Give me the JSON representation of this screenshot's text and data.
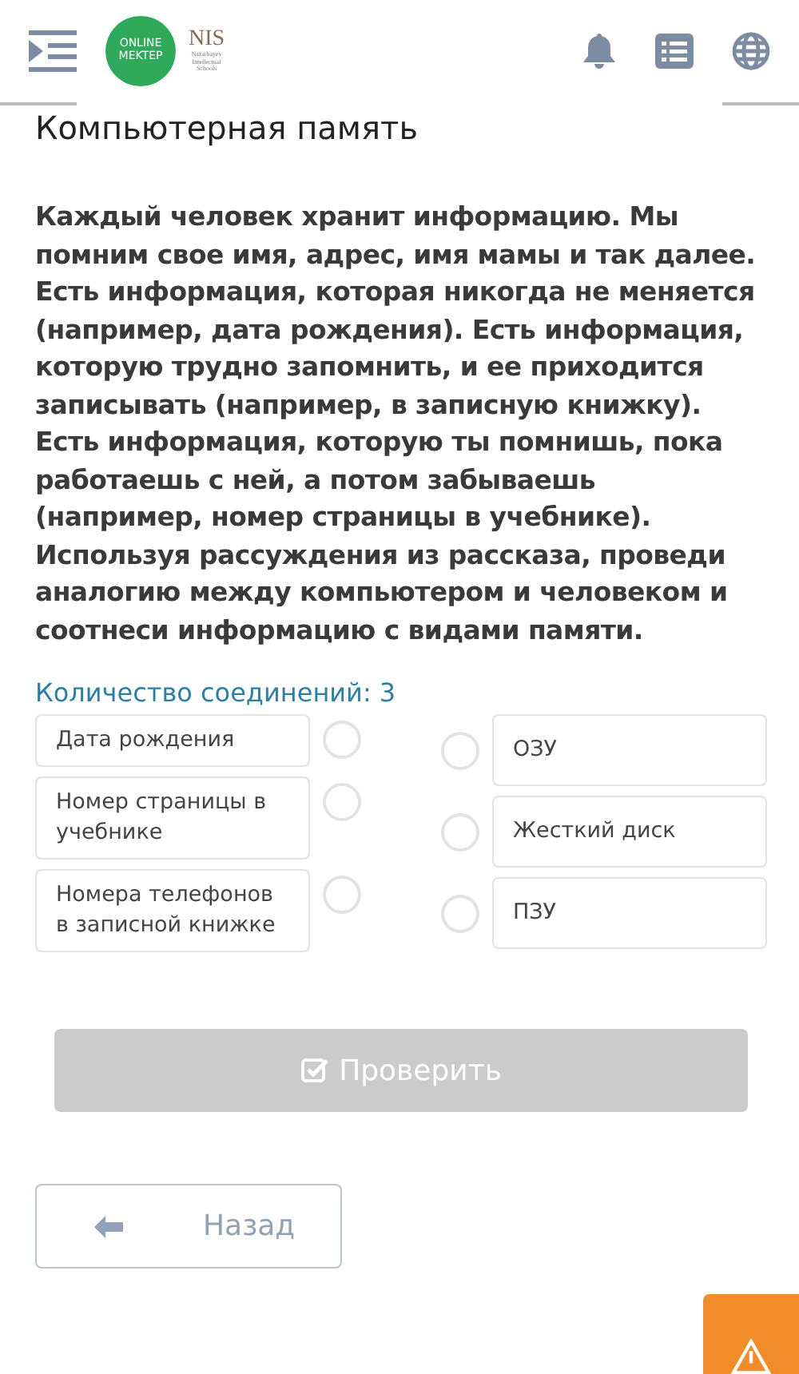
{
  "header": {
    "logo_main": [
      "ONLINE",
      "MEKTEP"
    ],
    "logo_nis": "NIS",
    "logo_nis_sub": [
      "Nazarbayev",
      "Intellectual",
      "Schools"
    ]
  },
  "title": "Компьютерная память",
  "question": "Каждый человек хранит информацию. Мы помним свое имя, адрес, имя мамы и так далее. Есть информация, которая никогда не меняется (например, дата рождения). Есть информация, которую трудно запомнить, и ее приходится записывать (например, в записную книжку). Есть информация, которую ты помнишь, пока работаешь с ней, а потом забываешь (например, номер страницы в учебнике). Используя рассуждения из рассказа, проведи аналогию между компьютером и человеком и соотнеси информацию с видами памяти.",
  "connections_label": "Количество соединений: 3",
  "left_items": [
    {
      "text": "Дата рождения",
      "selected": false
    },
    {
      "text": "Номер страницы в учебнике",
      "selected": false
    },
    {
      "text": "Номера телефонов в записной книжке",
      "selected": false
    }
  ],
  "right_items": [
    {
      "text": "ОЗУ",
      "selected": false
    },
    {
      "text": "Жесткий диск",
      "selected": false
    },
    {
      "text": "ПЗУ",
      "selected": false
    }
  ],
  "check_button": {
    "label": "Проверить",
    "disabled": true
  },
  "back_button": {
    "label": "Назад"
  }
}
